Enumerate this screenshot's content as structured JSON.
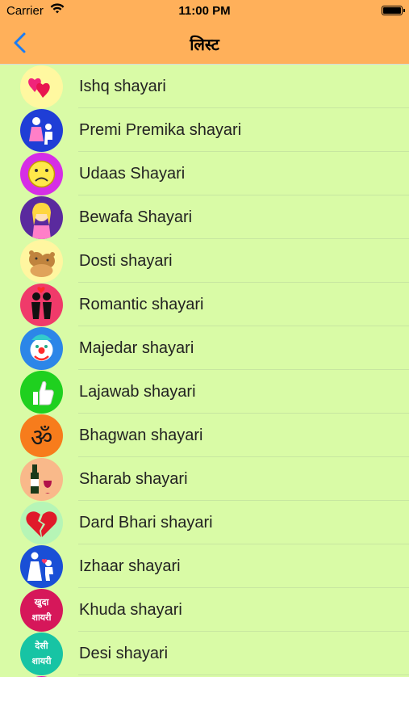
{
  "status_bar": {
    "carrier": "Carrier",
    "time": "11:00 PM"
  },
  "nav": {
    "title": "लिस्ट",
    "back_icon": "chevron-left-icon"
  },
  "colors": {
    "nav_background": "#ffb05a",
    "list_background": "#d9fba6",
    "back_tint": "#1a7cf5"
  },
  "items": [
    {
      "label": "Ishq shayari",
      "icon": "hearts-icon",
      "color": "#fff8a0"
    },
    {
      "label": "Premi Premika shayari",
      "icon": "proposal-icon",
      "color": "#1f3ed6"
    },
    {
      "label": "Udaas Shayari",
      "icon": "sad-face-icon",
      "color": "#d62ee6"
    },
    {
      "label": "Bewafa Shayari",
      "icon": "girl-icon",
      "color": "#5a2a9e"
    },
    {
      "label": "Dosti shayari",
      "icon": "teddy-bears-icon",
      "color": "#fff6a0"
    },
    {
      "label": "Romantic shayari",
      "icon": "kissing-couple-icon",
      "color": "#f03a6a"
    },
    {
      "label": "Majedar shayari",
      "icon": "clown-icon",
      "color": "#2c86e8"
    },
    {
      "label": "Lajawab shayari",
      "icon": "thumbs-up-icon",
      "color": "#1fd01f"
    },
    {
      "label": "Bhagwan shayari",
      "icon": "om-icon",
      "color": "#f77c1c"
    },
    {
      "label": "Sharab shayari",
      "icon": "wine-bottle-icon",
      "color": "#f9b98a"
    },
    {
      "label": "Dard Bhari shayari",
      "icon": "broken-heart-icon",
      "color": "#b6f5b6"
    },
    {
      "label": "Izhaar shayari",
      "icon": "kneeling-couple-icon",
      "color": "#1a4fd6"
    },
    {
      "label": "Khuda shayari",
      "icon": "khuda-text-icon",
      "color": "#d6175a",
      "text1": "खुदा",
      "text2": "शायरी"
    },
    {
      "label": "Desi shayari",
      "icon": "desi-text-icon",
      "color": "#17c4a4",
      "text1": "देसी",
      "text2": "शायरी"
    },
    {
      "label": "",
      "icon": "partial-icon",
      "color": "#e21ab8"
    }
  ]
}
